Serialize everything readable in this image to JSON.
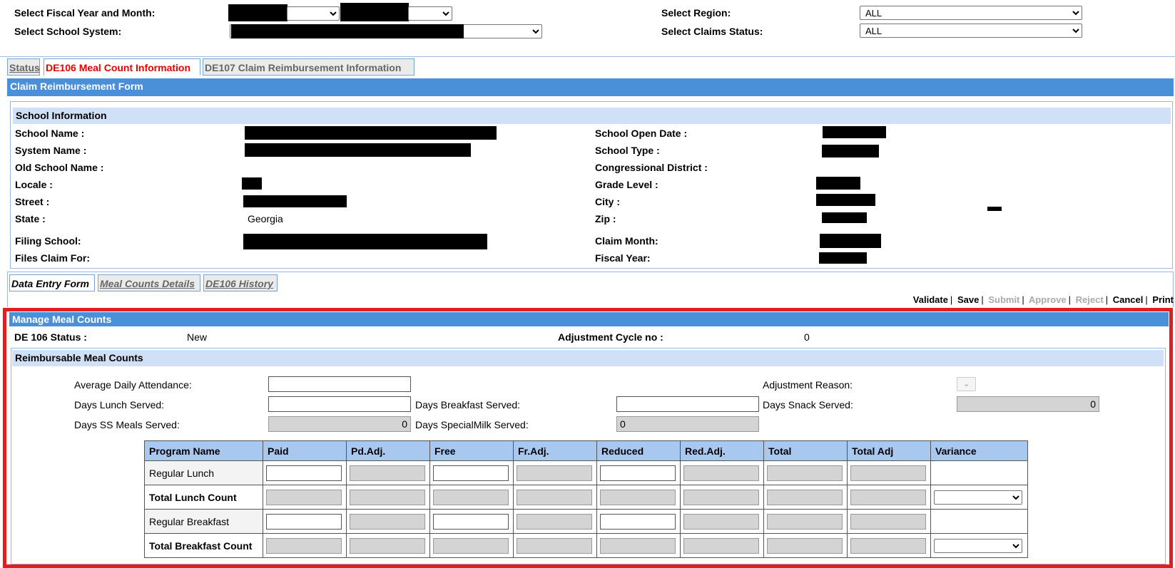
{
  "filters": {
    "fiscal_label": "Select Fiscal Year and Month:",
    "school_system_label": "Select School System:",
    "region_label": "Select Region:",
    "region_value": "ALL",
    "claims_status_label": "Select Claims Status:",
    "claims_status_value": "ALL"
  },
  "top_tabs": [
    {
      "label": "Status"
    },
    {
      "label": "DE106 Meal Count Information"
    },
    {
      "label": "DE107 Claim Reimbursement Information"
    }
  ],
  "form_header": "Claim Reimbursement Form",
  "school_info": {
    "header": "School Information",
    "school_name_label": "School Name :",
    "system_name_label": "System Name :",
    "old_school_name_label": "Old School Name :",
    "locale_label": "Locale :",
    "street_label": "Street :",
    "state_label": "State :",
    "state_value": "Georgia",
    "filing_school_label": "Filing School:",
    "files_claim_for_label": "Files Claim For:",
    "school_open_date_label": "School Open Date :",
    "school_type_label": "School Type :",
    "congressional_district_label": "Congressional District :",
    "grade_level_label": "Grade Level :",
    "city_label": "City :",
    "zip_label": "Zip :",
    "claim_month_label": "Claim Month:",
    "fiscal_year_label": "Fiscal Year:"
  },
  "sub_tabs": [
    {
      "label": "Data Entry Form"
    },
    {
      "label": "Meal Counts Details"
    },
    {
      "label": "DE106 History"
    }
  ],
  "actions": {
    "validate": "Validate",
    "save": "Save",
    "submit": "Submit",
    "approve": "Approve",
    "reject": "Reject",
    "cancel": "Cancel",
    "print": "Print",
    "sep": "|"
  },
  "manage": {
    "header": "Manage Meal Counts",
    "status_label": "DE 106 Status :",
    "status_value": "New",
    "adj_cycle_label": "Adjustment Cycle no :",
    "adj_cycle_value": "0"
  },
  "reimbursable": {
    "header": "Reimbursable Meal Counts",
    "ada_label": "Average Daily Attendance:",
    "adjustment_reason_label": "Adjustment Reason:",
    "days_lunch_label": "Days Lunch Served:",
    "days_breakfast_label": "Days Breakfast Served:",
    "days_snack_label": "Days Snack Served:",
    "days_snack_value": "0",
    "days_ss_label": "Days SS Meals Served:",
    "days_ss_value": "0",
    "days_specialmilk_label": "Days SpecialMilk Served:",
    "days_specialmilk_value": "0"
  },
  "grid": {
    "columns": [
      "Program Name",
      "Paid",
      "Pd.Adj.",
      "Free",
      "Fr.Adj.",
      "Reduced",
      "Red.Adj.",
      "Total",
      "Total Adj",
      "Variance"
    ],
    "rows": [
      "Regular Lunch",
      "Total Lunch Count",
      "Regular Breakfast",
      "Total Breakfast Count"
    ]
  }
}
